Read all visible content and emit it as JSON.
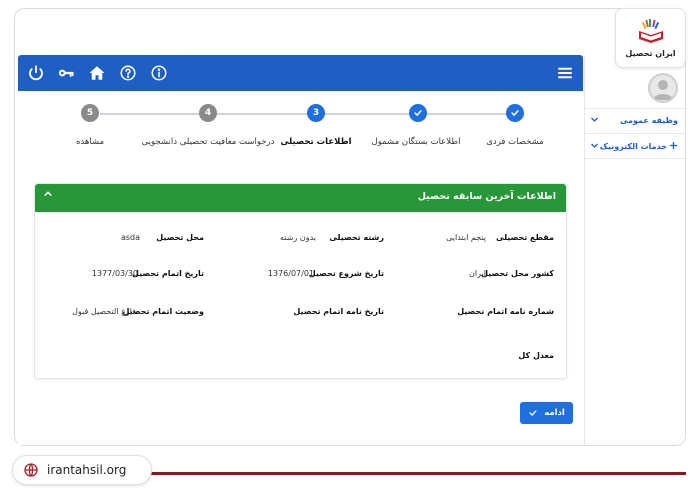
{
  "logo": {
    "text": "ایران تحصیل"
  },
  "footer": {
    "site": "irantahsil.org"
  },
  "topbar": {
    "icons": [
      "power-icon",
      "key-icon",
      "home-icon",
      "help-icon",
      "info-icon",
      "menu-icon"
    ]
  },
  "stepper": {
    "steps": [
      {
        "label": "مشخصات فردی",
        "number": "",
        "state": "done"
      },
      {
        "label": "اطلاعات بستگان مشمول",
        "number": "",
        "state": "done"
      },
      {
        "label": "اطلاعات تحصیلی",
        "number": "3",
        "state": "active"
      },
      {
        "label": "درخواست معافیت تحصیلی دانشجویی",
        "number": "4",
        "state": "todo"
      },
      {
        "label": "مشاهده",
        "number": "5",
        "state": "todo"
      }
    ]
  },
  "card": {
    "title": "اطلاعات آخرین سابقه تحصیل",
    "fields": {
      "grade_label": "مقطع تحصیلی",
      "grade_value": "پنجم ابتدایی",
      "major_label": "رشته تحصیلی",
      "major_value": "بدون رشته",
      "place_label": "محل تحصیل",
      "place_value": "asda",
      "country_label": "کشور محل تحصیل",
      "country_value": "ایران",
      "start_label": "تاریخ شروع تحصیل",
      "start_value": "1376/07/01",
      "end_label": "تاریخ اتمام تحصیل",
      "end_value": "1377/03/30",
      "cert_no_label": "شماره نامه اتمام تحصیل",
      "cert_date_label": "تاریخ نامه اتمام تحصیل",
      "status_label": "وضعیت اتمام تحصیل",
      "status_value": "فارغ التحصیل قبول",
      "gpa_label": "معدل کل"
    }
  },
  "actions": {
    "continue_label": "ادامه"
  },
  "sidebar": {
    "items": [
      {
        "label": "وظیفه عمومی"
      },
      {
        "label": "خدمات الکترونیک"
      }
    ]
  },
  "colors": {
    "topbar": "#1f5fc3",
    "accent": "#1f6fe0",
    "card_header": "#27973a",
    "footer_line": "#8b1720"
  }
}
